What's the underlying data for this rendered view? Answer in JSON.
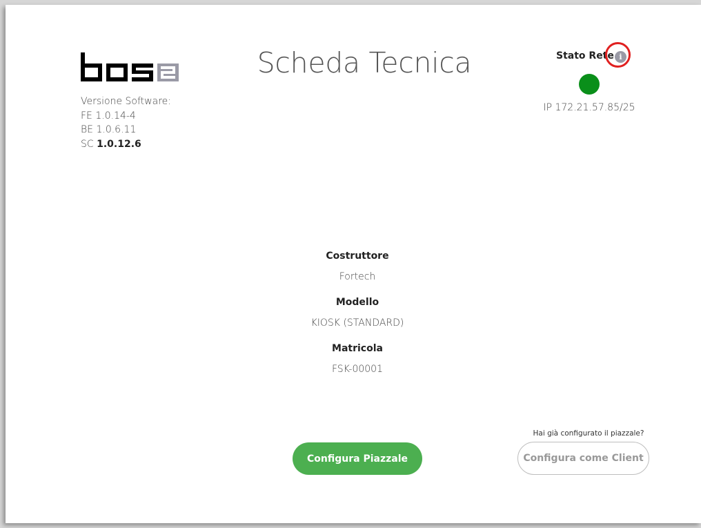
{
  "brand": {
    "logo_text": "bos2",
    "logo_color": "#000000",
    "logo_accent": "#9a9aa6"
  },
  "page": {
    "title": "Scheda Tecnica"
  },
  "software_version": {
    "label": "Versione Software:",
    "fe": "FE 1.0.14-4",
    "be": "BE 1.0.6.11",
    "sc_prefix": "SC",
    "sc_value": "1.0.12.6"
  },
  "network": {
    "label": "Stato Rete",
    "info_icon": "info-icon",
    "status": "online",
    "status_color": "#0a8f1a",
    "ip": "IP 172.21.57.85/25",
    "highlight_color": "#e02020"
  },
  "device": {
    "manufacturer_label": "Costruttore",
    "manufacturer": "Fortech",
    "model_label": "Modello",
    "model": "KIOSK (STANDARD)",
    "serial_label": "Matricola",
    "serial": "FSK-00001"
  },
  "actions": {
    "configure_yard": "Configura Piazzale",
    "client_hint": "Hai già configurato il piazzale?",
    "configure_client": "Configura come Client",
    "primary_color": "#4caf50"
  }
}
